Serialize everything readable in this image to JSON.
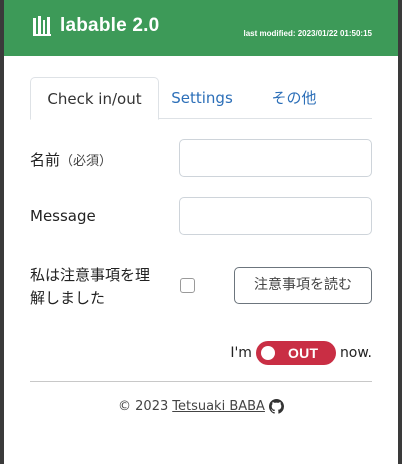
{
  "header": {
    "title": "labable 2.0",
    "last_modified": "last modified: 2023/01/22 01:50:15",
    "logo_icon": "bookshelf-icon"
  },
  "colors": {
    "header_bg": "#3d9a58",
    "link": "#2c6fb8",
    "toggle_out": "#c92e44"
  },
  "tabs": [
    {
      "label": "Check in/out",
      "active": true
    },
    {
      "label": "Settings",
      "active": false
    },
    {
      "label": "その他",
      "active": false
    }
  ],
  "form": {
    "name_label": "名前",
    "name_sub": "（必須）",
    "name_value": "",
    "message_label": "Message",
    "message_value": "",
    "agree_label_line1": "私は注意事項を理",
    "agree_label_line2": "解しました",
    "agree_checked": false,
    "notes_button": "注意事項を読む"
  },
  "status": {
    "prefix": "I'm",
    "toggle_label": "OUT",
    "suffix": "now."
  },
  "footer": {
    "copyright": "© 2023",
    "author": "Tetsuaki BABA",
    "icon": "github-icon"
  }
}
